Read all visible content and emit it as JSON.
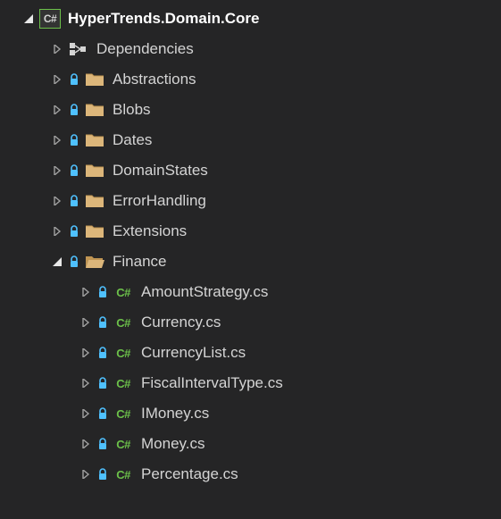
{
  "project": {
    "name": "HyperTrends.Domain.Core",
    "icon_label": "C#"
  },
  "dependencies": {
    "label": "Dependencies"
  },
  "folders": [
    {
      "label": "Abstractions",
      "expanded": false
    },
    {
      "label": "Blobs",
      "expanded": false
    },
    {
      "label": "Dates",
      "expanded": false
    },
    {
      "label": "DomainStates",
      "expanded": false
    },
    {
      "label": "ErrorHandling",
      "expanded": false
    },
    {
      "label": "Extensions",
      "expanded": false
    },
    {
      "label": "Finance",
      "expanded": true
    }
  ],
  "files": [
    {
      "label": "AmountStrategy.cs",
      "badge": "C#"
    },
    {
      "label": "Currency.cs",
      "badge": "C#"
    },
    {
      "label": "CurrencyList.cs",
      "badge": "C#"
    },
    {
      "label": "FiscalIntervalType.cs",
      "badge": "C#"
    },
    {
      "label": "IMoney.cs",
      "badge": "C#"
    },
    {
      "label": "Money.cs",
      "badge": "C#"
    },
    {
      "label": "Percentage.cs",
      "badge": "C#"
    }
  ]
}
